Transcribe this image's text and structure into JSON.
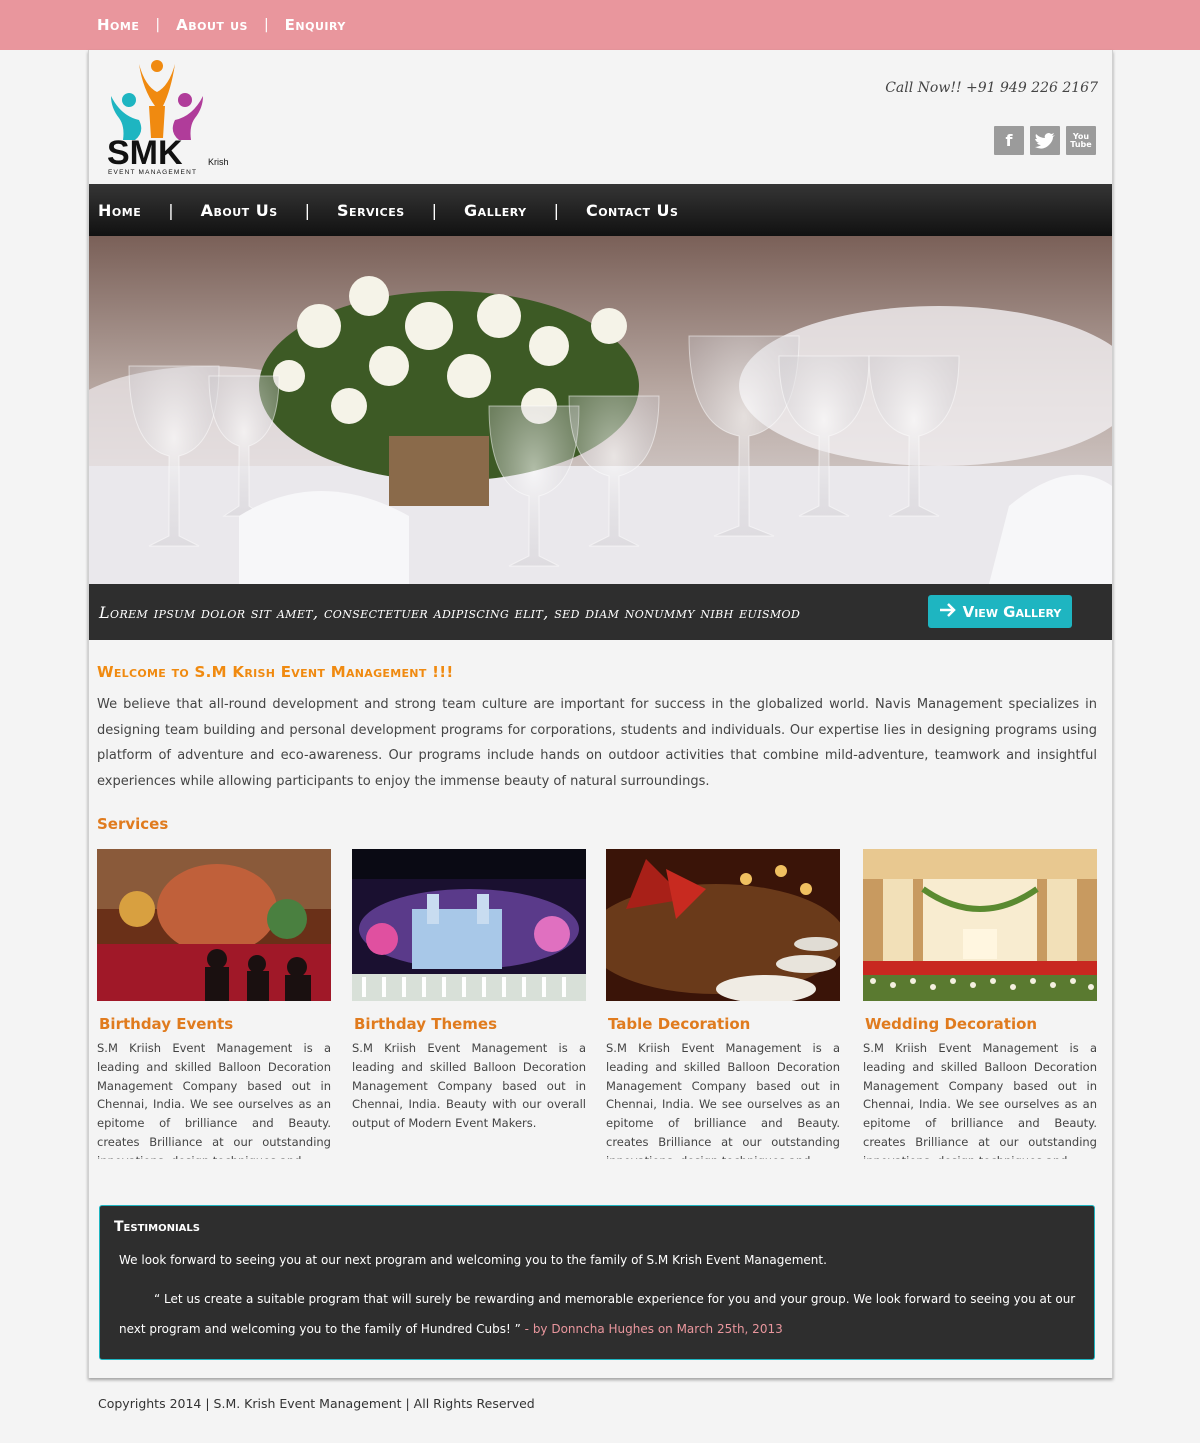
{
  "top_links": [
    "Home",
    "About us",
    "Enquiry"
  ],
  "logo": {
    "brand": "SMK",
    "sub": "Krish",
    "tagline": "EVENT MANAGEMENT"
  },
  "header": {
    "call": "Call Now!!  +91 949 226 2167"
  },
  "social": [
    {
      "name": "facebook-icon",
      "glyph": "f"
    },
    {
      "name": "twitter-icon",
      "glyph": "t"
    },
    {
      "name": "youtube-icon",
      "glyph": "You Tube"
    }
  ],
  "nav": [
    "Home",
    "About Us",
    "Services",
    "Gallery",
    "Contact Us"
  ],
  "hero": {
    "caption": "Lorem ipsum dolor sit amet, consectetuer adipiscing elit, sed diam nonummy nibh euismod",
    "button": "View Gallery"
  },
  "welcome": {
    "title": "Welcome to S.M Krish Event Management !!!",
    "text": "We believe that all-round development and strong team culture are important for success in the globalized world. Navis Management specializes in design­ing team building and personal development programs for corporations, students and individuals. Our expertise lies in designing programs using platform of adventure and eco-awareness. Our programs include hands on outdoor activities that combine mild-adventure, teamwork and insightful experiences while allowing participants to enjoy the immense beauty of natural surroundings."
  },
  "services": {
    "title": "Services",
    "items": [
      {
        "name": "Birthday Events",
        "desc": "S.M Kriish Event Management is a leading and skilled Balloon Decoration Management Company based out in Chennai, India. We see ourselves as an epitome of brilliance and Beauty. creates Brilliance at our outstanding innovations, design techniques and"
      },
      {
        "name": "Birthday Themes",
        "desc": "S.M Kriish Event Management is a leading and skilled Balloon Decoration Management Company based out in Chennai, India. Beauty with our overall output of Modern Event Makers."
      },
      {
        "name": "Table Decoration",
        "desc": "S.M Kriish Event Management is a leading and skilled Balloon Decoration Management Company based out in Chennai, India. We see ourselves as an epitome of brilliance and Beauty. creates Brilliance at our outstanding innovations, design techniques and"
      },
      {
        "name": "Wedding Decoration",
        "desc": "S.M Kriish Event Management is a leading and skilled Balloon Decoration Management Company based out in Chennai, India. We see ourselves as an epitome of brilliance and Beauty. creates Brilliance at our outstanding innovations, design techniques and"
      }
    ]
  },
  "testimonials": {
    "title": "Testimonials",
    "line1": "We look forward to  seeing you at our next program and welcoming you to the family of  S.M Krish Event Management.",
    "quote": "“ Let us create a suitable program that will surely be rewarding and memorable experience for you and your group. We look forward to  seeing you at our next program and welcoming you to the family of Hundred Cubs! ”",
    "author": " - by Donncha Hughes on March 25th, 2013"
  },
  "footer": "Copyrights 2014  |  S.M. Krish Event Management   |  All Rights Reserved",
  "colors": {
    "topbar": "#e9969d",
    "accent": "#1eb5c1",
    "orange": "#f08a10",
    "dark": "#2e2e2e"
  }
}
